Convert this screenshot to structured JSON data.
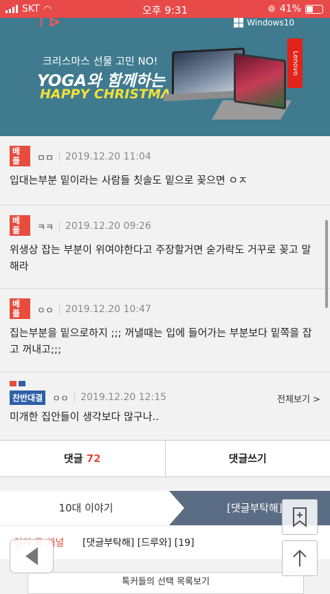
{
  "status": {
    "carrier": "SKT",
    "time": "오후 9:31",
    "battery": "41%"
  },
  "banner": {
    "os_label": "Windows10",
    "line1": "크리스마스 선물 고민 NO!",
    "line2": "YOGA와 함께하는",
    "line3": "HAPPY CHRISTMAS",
    "brand": "Lenovo"
  },
  "comments": [
    {
      "badge": "베플",
      "nick": "ㅁㅁ",
      "date": "2019.12.20 11:04",
      "text": "입대는부분 밑이라는 사람들 칫솔도 밑으로 꽂으면 ㅇㅈ"
    },
    {
      "badge": "베플",
      "nick": "ㅋㅋ",
      "date": "2019.12.20 09:26",
      "text": "위생상 잡는 부분이 위여야한다고 주장할거면 숟가락도 거꾸로 꽂고 말해라"
    },
    {
      "badge": "베플",
      "nick": "ㅇㅇ",
      "date": "2019.12.20 10:47",
      "text": "집는부분을 밑으로하지 ;;; 꺼낼때는 입에 들어가는 부분보다 밑쪽을 잡고 꺼내고;;;"
    },
    {
      "badge": "찬반대결",
      "nick": "ㅇㅇ",
      "date": "2019.12.20 12:15",
      "text": "미개한 집안들이 생각보다 많구나..",
      "view_all": "전체보기 >"
    }
  ],
  "actions": {
    "comment_label": "댓글",
    "comment_count": "72",
    "write_label": "댓글쓰기"
  },
  "tabs": {
    "tab1": "10대 이야기",
    "tab2": "[댓글부탁해]"
  },
  "popular": {
    "label": "인기 톡 채널",
    "value": "[댓글부탁해] [드루와] [19]"
  },
  "more_button": "톡커들의 선택 목록보기",
  "colors": {
    "status_bar": "#e84a4a",
    "banner_bg": "#3f7a8f",
    "best_tag": "#e74c3c",
    "versus_tag": "#2e5fa8",
    "tab_active": "#5b6d84"
  }
}
